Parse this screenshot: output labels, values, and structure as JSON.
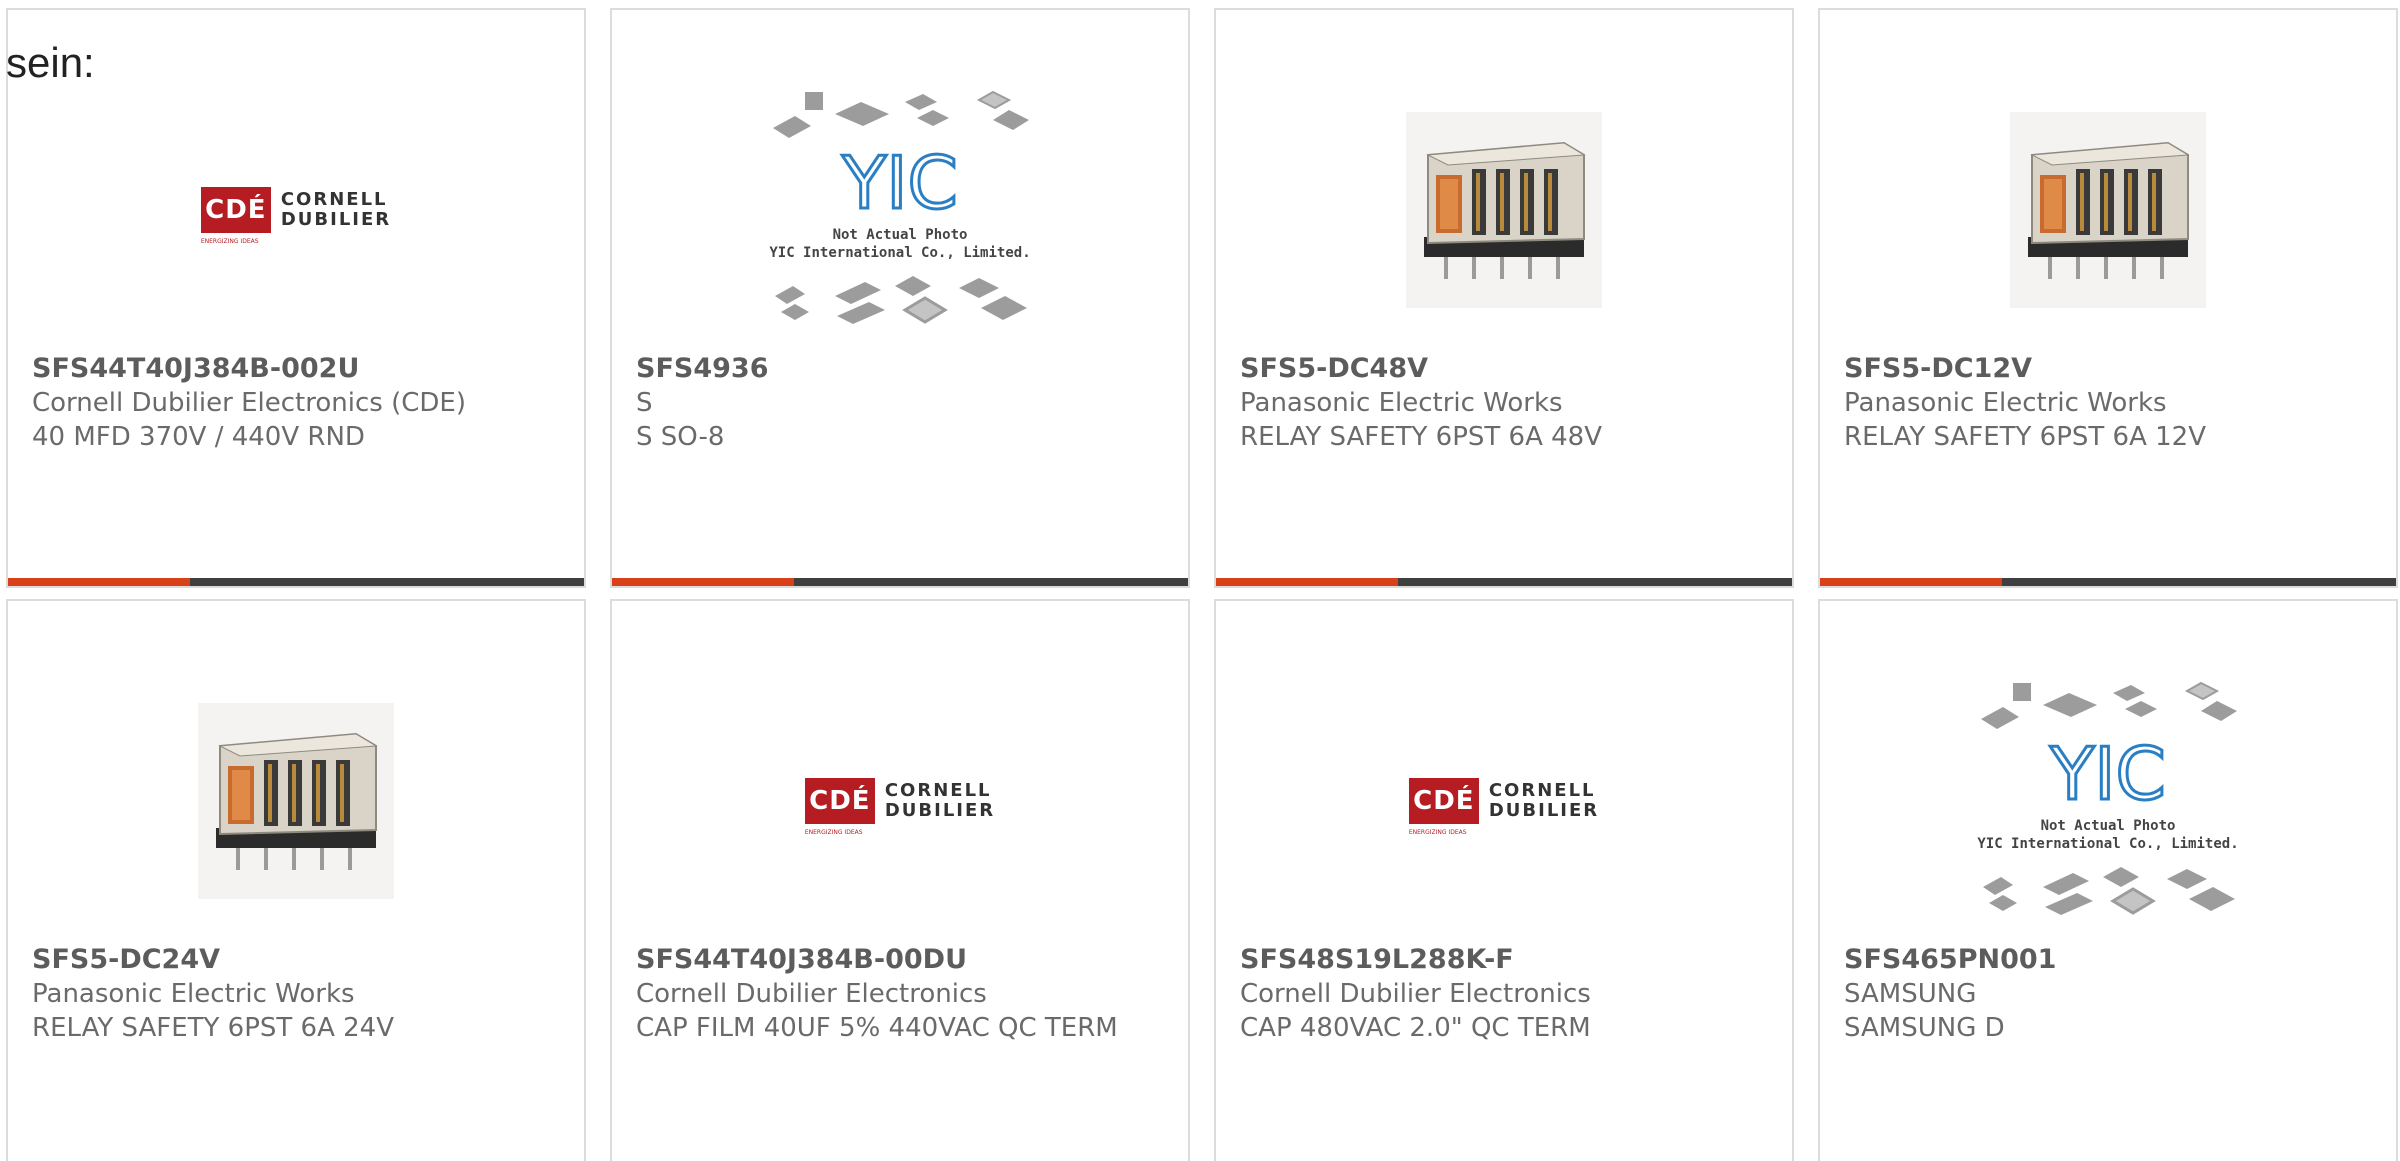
{
  "intro_text": "sein:",
  "placeholder_photo": {
    "line1": "Not Actual Photo",
    "line2": "YIC International Co., Limited."
  },
  "cde_logo": {
    "mark": "CDÉ",
    "line1": "CORNELL",
    "line2": "DUBILIER",
    "tagline": "ENERGIZING IDEAS"
  },
  "products": [
    {
      "part": "SFS44T40J384B-002U",
      "maker": "Cornell Dubilier Electronics (CDE)",
      "desc": "40 MFD 370V / 440V RND",
      "image": "cde-logo"
    },
    {
      "part": "SFS4936",
      "maker": "S",
      "desc": "S SO-8",
      "image": "placeholder"
    },
    {
      "part": "SFS5-DC48V",
      "maker": "Panasonic Electric Works",
      "desc": "RELAY SAFETY 6PST 6A 48V",
      "image": "relay-photo"
    },
    {
      "part": "SFS5-DC12V",
      "maker": "Panasonic Electric Works",
      "desc": "RELAY SAFETY 6PST 6A 12V",
      "image": "relay-photo"
    },
    {
      "part": "SFS5-DC24V",
      "maker": "Panasonic Electric Works",
      "desc": "RELAY SAFETY 6PST 6A 24V",
      "image": "relay-photo"
    },
    {
      "part": "SFS44T40J384B-00DU",
      "maker": "Cornell Dubilier Electronics",
      "desc": "CAP FILM 40UF 5% 440VAC QC TERM",
      "image": "cde-logo"
    },
    {
      "part": "SFS48S19L288K-F",
      "maker": "Cornell Dubilier Electronics",
      "desc": "CAP 480VAC 2.0\" QC TERM",
      "image": "cde-logo"
    },
    {
      "part": "SFS465PN001",
      "maker": "SAMSUNG",
      "desc": "SAMSUNG D",
      "image": "placeholder"
    }
  ],
  "colors": {
    "accent": "#d8401a",
    "bar": "#3f3f3f",
    "border": "#dcdcdc",
    "cde_red": "#b51d22",
    "yic_blue": "#2a7fc4"
  }
}
